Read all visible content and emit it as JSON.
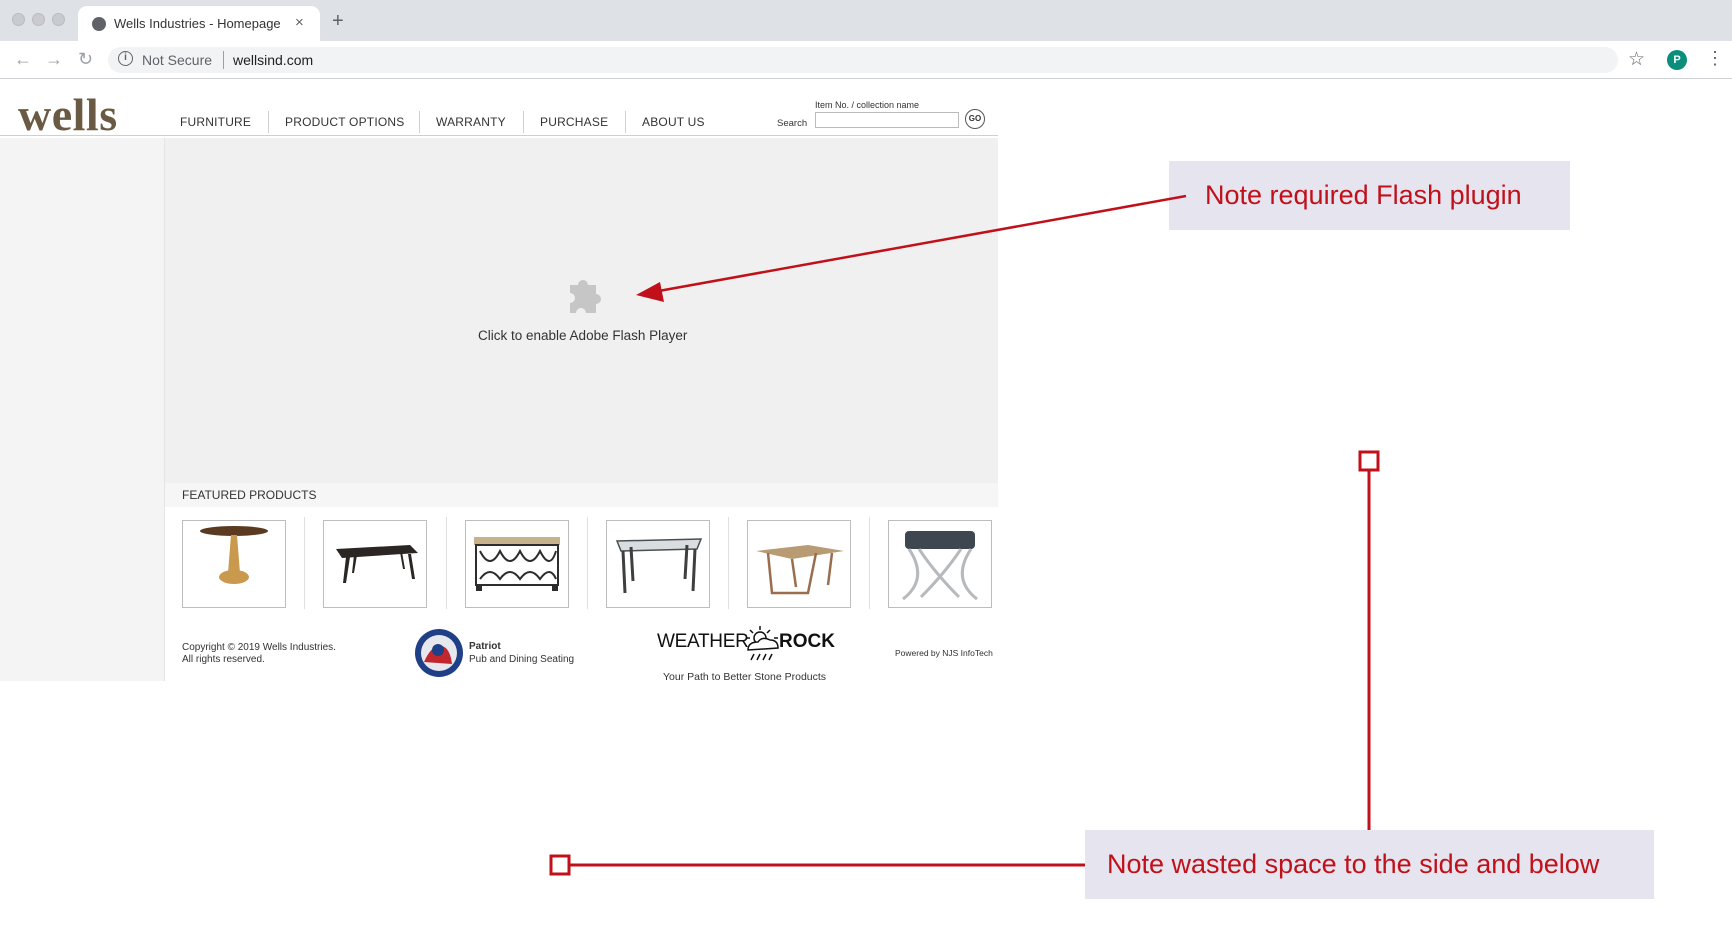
{
  "browser": {
    "tab_title": "Wells Industries - Homepage",
    "new_tab": "+",
    "close": "×",
    "security": "Not Secure",
    "url": "wellsind.com",
    "profile_initial": "P",
    "info_glyph": "i"
  },
  "site": {
    "logo": "wells",
    "nav": [
      "FURNITURE",
      "PRODUCT OPTIONS",
      "WARRANTY",
      "PURCHASE",
      "ABOUT US"
    ],
    "search": {
      "hint": "Item No. / collection name",
      "label": "Search",
      "go": "GO"
    },
    "flash_message": "Click to enable Adobe Flash Player",
    "featured_title": "FEATURED PRODUCTS",
    "products": [
      {
        "icon": "round-pedestal-table-icon"
      },
      {
        "icon": "dining-table-icon"
      },
      {
        "icon": "ornate-console-table-icon"
      },
      {
        "icon": "glass-top-table-icon"
      },
      {
        "icon": "wood-coffee-table-icon"
      },
      {
        "icon": "upholstered-bench-icon"
      }
    ],
    "footer": {
      "copyright_line1": "Copyright © 2019 Wells Industries.",
      "copyright_line2": "All rights reserved.",
      "patriot_name": "Patriot",
      "patriot_sub": "Pub and Dining Seating",
      "weather": "WEATHER",
      "rock": "ROCK",
      "weather_tagline": "Your Path to Better Stone Products",
      "powered_by": "Powered by NJS InfoTech"
    }
  },
  "annotations": {
    "flash_note": "Note required Flash plugin",
    "space_note": "Note wasted space to the side and below",
    "color": "#c0111b"
  }
}
